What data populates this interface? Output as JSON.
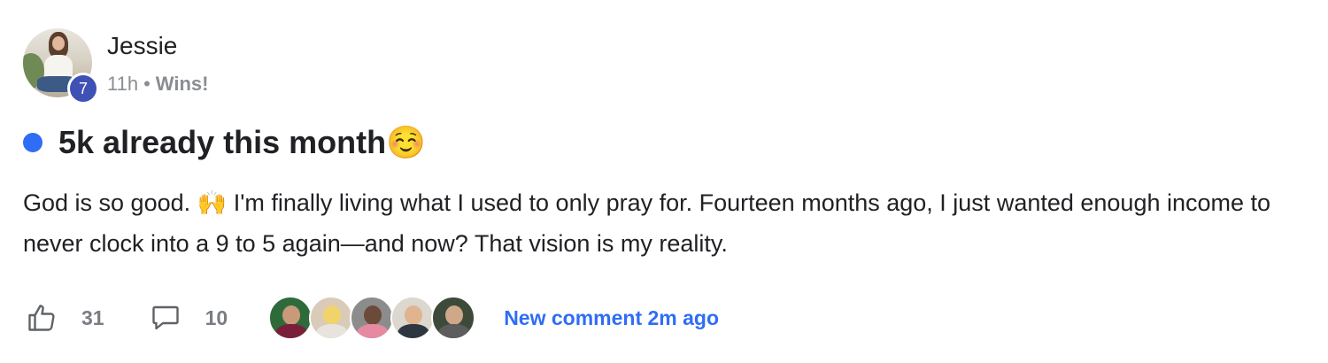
{
  "post": {
    "author": {
      "name": "Jessie",
      "level": "7"
    },
    "meta": {
      "time": "11h",
      "separator": "•",
      "category": "Wins!"
    },
    "title": "5k already this month☺️",
    "body": "God is so good. 🙌 I'm finally living what I used to only pray for. Fourteen months ago, I just wanted enough income to never clock into a 9 to 5 again—and now? That vision is my reality.",
    "likes": "31",
    "comments": "10",
    "commenter_avatars": [
      "commenter-avatar",
      "commenter-avatar",
      "commenter-avatar",
      "commenter-avatar",
      "commenter-avatar"
    ],
    "new_comment": "New comment 2m ago"
  },
  "icons": {
    "like": "thumbs-up-icon",
    "comment": "speech-bubble-icon"
  },
  "colors": {
    "accent": "#2f6df6",
    "level_badge": "#3f51b5",
    "muted_text": "#8a8d91",
    "count_text": "#7a7d82"
  }
}
